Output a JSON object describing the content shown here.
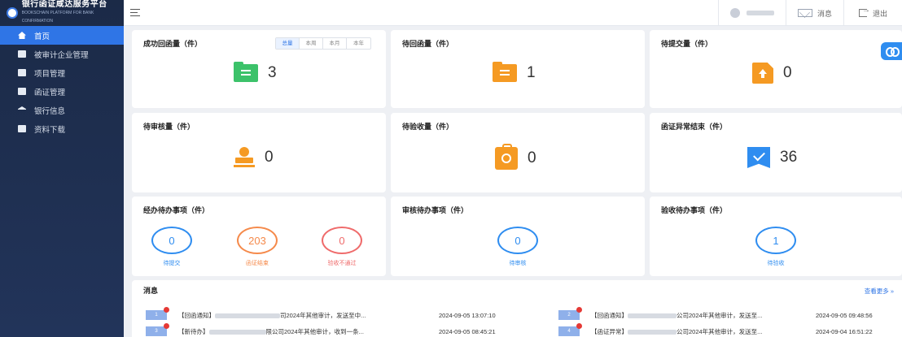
{
  "brand": {
    "title": "银行函证咸达服务平台",
    "subtitle": "BOOKSCHAIN PLATFORM FOR BANK CONFIRMATION"
  },
  "sidebar": {
    "items": [
      {
        "label": "首页",
        "active": true
      },
      {
        "label": "被审计企业管理"
      },
      {
        "label": "项目管理"
      },
      {
        "label": "函证管理"
      },
      {
        "label": "银行信息"
      },
      {
        "label": "资料下载"
      }
    ]
  },
  "topbar": {
    "message_label": "消息",
    "logout_label": "退出"
  },
  "cards": {
    "success": {
      "title": "成功回函量（件）",
      "value": "3",
      "tabs": [
        "总量",
        "本周",
        "本月",
        "本年"
      ]
    },
    "pending_reply": {
      "title": "待回函量（件）",
      "value": "1"
    },
    "pending_submit": {
      "title": "待提交量（件）",
      "value": "0"
    },
    "pending_review": {
      "title": "待审核量（件）",
      "value": "0"
    },
    "pending_accept": {
      "title": "待验收量（件）",
      "value": "0"
    },
    "abnormal_end": {
      "title": "函证异常结束（件）",
      "value": "36"
    }
  },
  "todo": {
    "handle": {
      "title": "经办待办事项（件）",
      "rings": [
        {
          "value": "0",
          "label": "待提交",
          "color": "#2f8df0"
        },
        {
          "value": "203",
          "label": "函证结束",
          "color": "#f58a4b"
        },
        {
          "value": "0",
          "label": "验收不通过",
          "color": "#ef6b6b"
        }
      ]
    },
    "review": {
      "title": "审核待办事项（件）",
      "ring": {
        "value": "0",
        "label": "待审核",
        "color": "#2f8df0"
      }
    },
    "accept": {
      "title": "验收待办事项（件）",
      "ring": {
        "value": "1",
        "label": "待验收",
        "color": "#2f8df0"
      }
    }
  },
  "messages": {
    "title": "消息",
    "more": "查看更多 »",
    "items": [
      {
        "num": "1",
        "prefix": "【回函通知】",
        "tail": "司2024年其他审计，发送至中...",
        "time": "2024-09-05 13:07:10"
      },
      {
        "num": "2",
        "prefix": "【回函通知】",
        "tail": "公司2024年其他审计，发送至...",
        "time": "2024-09-05 09:48:56"
      },
      {
        "num": "3",
        "prefix": "【新待办】",
        "tail": "限公司2024年其他审计，收到一条...",
        "time": "2024-09-05 08:45:21"
      },
      {
        "num": "4",
        "prefix": "【函证异常】",
        "tail": "公司2024年其他审计，发送至...",
        "time": "2024-09-04 16:51:22"
      }
    ]
  },
  "colors": {
    "accent": "#2f75e6",
    "sidebar": "#1b2a47",
    "orange": "#f59a23",
    "green": "#3cc26a"
  }
}
